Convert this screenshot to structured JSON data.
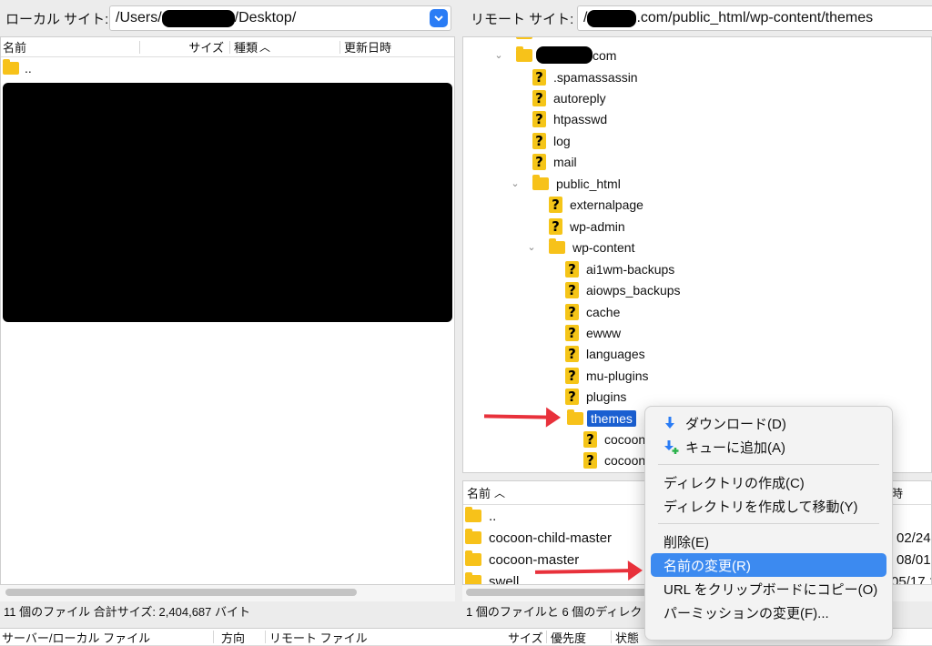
{
  "local": {
    "label": "ローカル サイト:",
    "path_prefix": "/Users/",
    "path_suffix": "/Desktop/",
    "columns": {
      "name": "名前",
      "size": "サイズ",
      "type": "種類",
      "modified": "更新日時"
    },
    "parent_row": "..",
    "status": "11 個のファイル 合計サイズ: 2,404,687 バイト"
  },
  "remote": {
    "label": "リモート サイト:",
    "path_prefix": "/",
    "path_suffix": ".com/public_html/wp-content/themes",
    "tree": {
      "domain_suffix": "com",
      "items": [
        ".spamassassin",
        "autoreply",
        "htpasswd",
        "log",
        "mail"
      ],
      "public_html": "public_html",
      "ph_items": [
        "externalpage",
        "wp-admin"
      ],
      "wp_content": "wp-content",
      "wc_items": [
        "ai1wm-backups",
        "aiowps_backups",
        "cache",
        "ewww",
        "languages",
        "mu-plugins",
        "plugins"
      ],
      "themes": "themes",
      "theme_items": [
        "cocoon",
        "cocoon"
      ]
    },
    "list": {
      "col_name": "名前",
      "col_modified": "時",
      "rows": [
        {
          "name": "..",
          "date": ""
        },
        {
          "name": "cocoon-child-master",
          "date": "02/24"
        },
        {
          "name": "cocoon-master",
          "date": "08/01"
        },
        {
          "name": "swell",
          "date": "05/17 1"
        }
      ]
    },
    "status": "1 個のファイルと 6 個のディレクト"
  },
  "queue": {
    "col_server": "サーバー/ローカル ファイル",
    "col_direction": "方向",
    "col_remote": "リモート ファイル",
    "col_size": "サイズ",
    "col_priority": "優先度",
    "col_status": "状態"
  },
  "context_menu": {
    "items": [
      {
        "label": "ダウンロード(D)",
        "icon": "download-icon"
      },
      {
        "label": "キューに追加(A)",
        "icon": "add-to-queue-icon"
      },
      {
        "label": "ディレクトリの作成(C)"
      },
      {
        "label": "ディレクトリを作成して移動(Y)"
      },
      {
        "label": "削除(E)"
      },
      {
        "label": "名前の変更(R)",
        "selected": true
      },
      {
        "label": "URL をクリップボードにコピー(O)"
      },
      {
        "label": "パーミッションの変更(F)..."
      }
    ]
  },
  "colors": {
    "accent": "#3c8af0",
    "arrow": "#e8313b",
    "folder": "#f7c21a"
  }
}
